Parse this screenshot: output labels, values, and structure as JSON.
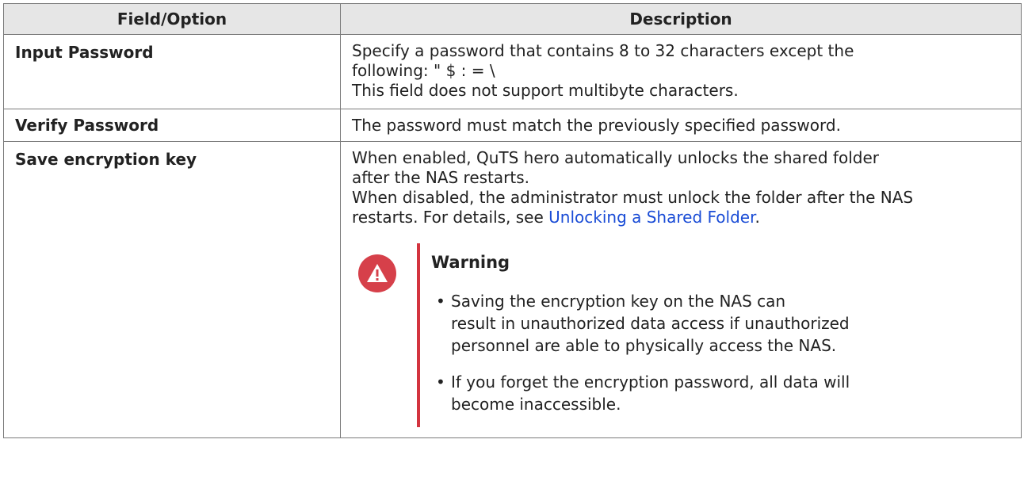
{
  "table": {
    "headers": {
      "field": "Field/Option",
      "description": "Description"
    },
    "rows": [
      {
        "field": "Input Password",
        "lines": [
          "Specify a password that contains 8 to 32 characters except the",
          "following: \" $ : = \\",
          "This field does not support multibyte characters."
        ]
      },
      {
        "field": "Verify Password",
        "lines": [
          "The password must match the previously specified password."
        ]
      },
      {
        "field": "Save encryption key",
        "lines": [
          "When enabled, QuTS hero automatically unlocks the shared folder",
          "after the NAS restarts.",
          "When disabled, the administrator must unlock the folder after the NAS",
          "restarts. For details, see "
        ],
        "link_text": "Unlocking a Shared Folder",
        "after_link": ".",
        "warning": {
          "title": "Warning",
          "icon": "warning-icon",
          "items": [
            {
              "lines": [
                "Saving the encryption key on the NAS can",
                "result in unauthorized data access if unauthorized",
                "personnel are able to physically access the NAS."
              ]
            },
            {
              "lines": [
                "If you forget the encryption password, all data will",
                "become inaccessible."
              ]
            }
          ]
        }
      }
    ]
  },
  "colors": {
    "header_bg": "#e6e6e6",
    "border": "#7a7a7a",
    "link": "#1a4cd6",
    "warning_accent": "#d3343f"
  }
}
